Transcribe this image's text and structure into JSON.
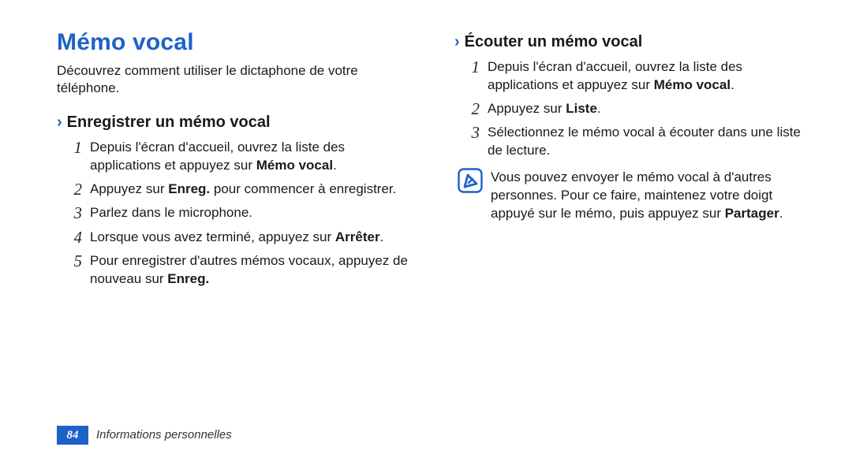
{
  "title": "Mémo vocal",
  "intro": "Découvrez comment utiliser le dictaphone de votre téléphone.",
  "chevron_glyph": "›",
  "section_record": {
    "heading": "Enregistrer un mémo vocal",
    "steps": {
      "n1": {
        "num": "1",
        "pre": "Depuis l'écran d'accueil, ouvrez la liste des applications et appuyez sur ",
        "bold": "Mémo vocal",
        "post": "."
      },
      "n2": {
        "num": "2",
        "pre": "Appuyez sur ",
        "bold": "Enreg.",
        "post": " pour commencer à enregistrer."
      },
      "n3": {
        "num": "3",
        "pre": "Parlez dans le microphone.",
        "bold": "",
        "post": ""
      },
      "n4": {
        "num": "4",
        "pre": "Lorsque vous avez terminé, appuyez sur ",
        "bold": "Arrêter",
        "post": "."
      },
      "n5": {
        "num": "5",
        "pre": "Pour enregistrer d'autres mémos vocaux, appuyez de nouveau sur ",
        "bold": "Enreg.",
        "post": ""
      }
    }
  },
  "section_listen": {
    "heading": "Écouter un mémo vocal",
    "steps": {
      "n1": {
        "num": "1",
        "pre": "Depuis l'écran d'accueil, ouvrez la liste des applications et appuyez sur ",
        "bold": "Mémo vocal",
        "post": "."
      },
      "n2": {
        "num": "2",
        "pre": "Appuyez sur ",
        "bold": "Liste",
        "post": "."
      },
      "n3": {
        "num": "3",
        "pre": "Sélectionnez le mémo vocal à écouter dans une liste de lecture.",
        "bold": "",
        "post": ""
      }
    },
    "note": {
      "pre": "Vous pouvez envoyer le mémo vocal à d'autres personnes. Pour ce faire, maintenez votre doigt appuyé sur le mémo, puis appuyez sur ",
      "bold": "Partager",
      "post": "."
    }
  },
  "footer": {
    "page_number": "84",
    "text": "Informations personnelles"
  }
}
